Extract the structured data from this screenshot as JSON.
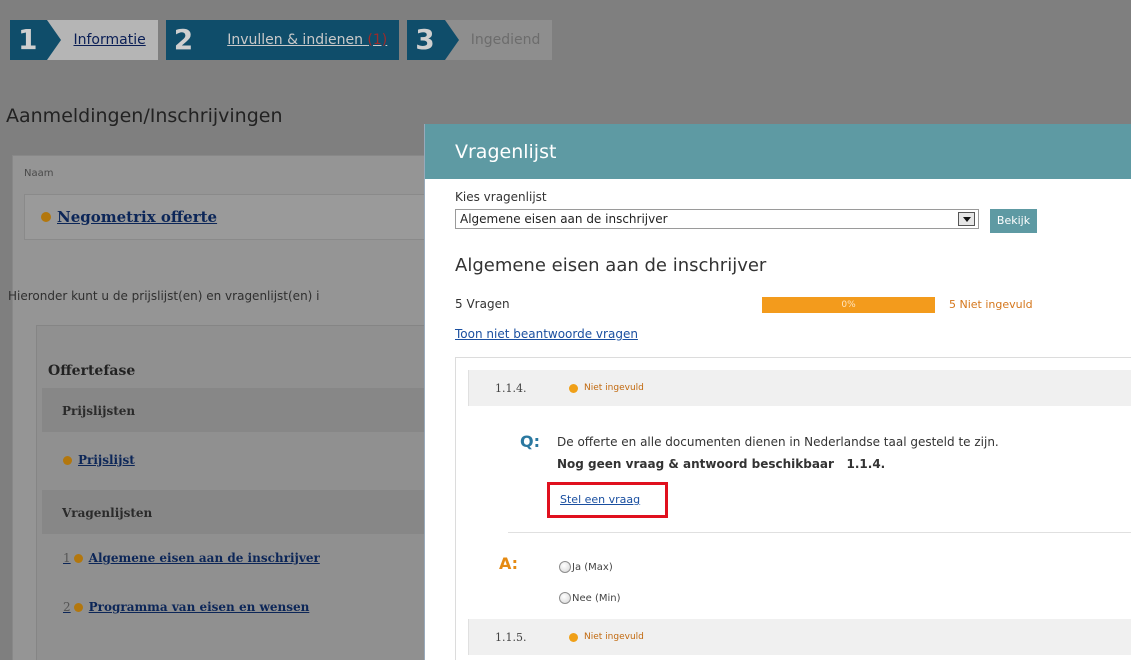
{
  "steps": [
    {
      "num": "1",
      "label": "Informatie"
    },
    {
      "num": "2",
      "label": "Invullen & indienen",
      "count": "(1)"
    },
    {
      "num": "3",
      "label": "Ingediend"
    }
  ],
  "page_title": "Aanmeldingen/Inschrijvingen",
  "list": {
    "naam_header": "Naam",
    "tender_name": "Negometrix offerte",
    "intro": "Hieronder kunt u de prijslijst(en) en vragenlijst(en) i",
    "phase": "Offertefase",
    "prijslijsten_header": "Prijslijsten",
    "prijslijst_link": "Prijslijst",
    "vragenlijsten_header": "Vragenlijsten",
    "vragenlijsten": [
      {
        "index": "1",
        "label": "Algemene eisen aan de inschrijver"
      },
      {
        "index": "2",
        "label": "Programma van eisen en wensen"
      }
    ]
  },
  "modal": {
    "title": "Vragenlijst",
    "kies_label": "Kies vragenlijst",
    "selected": "Algemene eisen aan de inschrijver",
    "bekijk_label": "Bekijk",
    "heading": "Algemene eisen aan de inschrijver",
    "vragen_count": "5 Vragen",
    "progress_label": "0%",
    "progress_value": 0,
    "niet_count": "5 Niet ingevuld",
    "toon_link": "Toon niet beantwoorde vragen",
    "questions": [
      {
        "number": "1.1.4.",
        "status": "Niet ingevuld",
        "q_label": "Q:",
        "text": "De offerte en alle documenten dienen in Nederlandse taal gesteld te zijn.",
        "no_answer": "Nog geen vraag & antwoord beschikbaar",
        "no_answer_ref": "1.1.4.",
        "ask_link": "Stel een vraag",
        "a_label": "A:",
        "options": [
          "Ja (Max)",
          "Nee (Min)"
        ]
      },
      {
        "number": "1.1.5.",
        "status": "Niet ingevuld"
      }
    ]
  },
  "colors": {
    "step_bg": "#0f4d6a",
    "modal_header": "#5e9aa3",
    "progress": "#f39b1c",
    "highlight": "#e0101e",
    "q_label": "#2a78a0",
    "a_label": "#e58a12"
  }
}
